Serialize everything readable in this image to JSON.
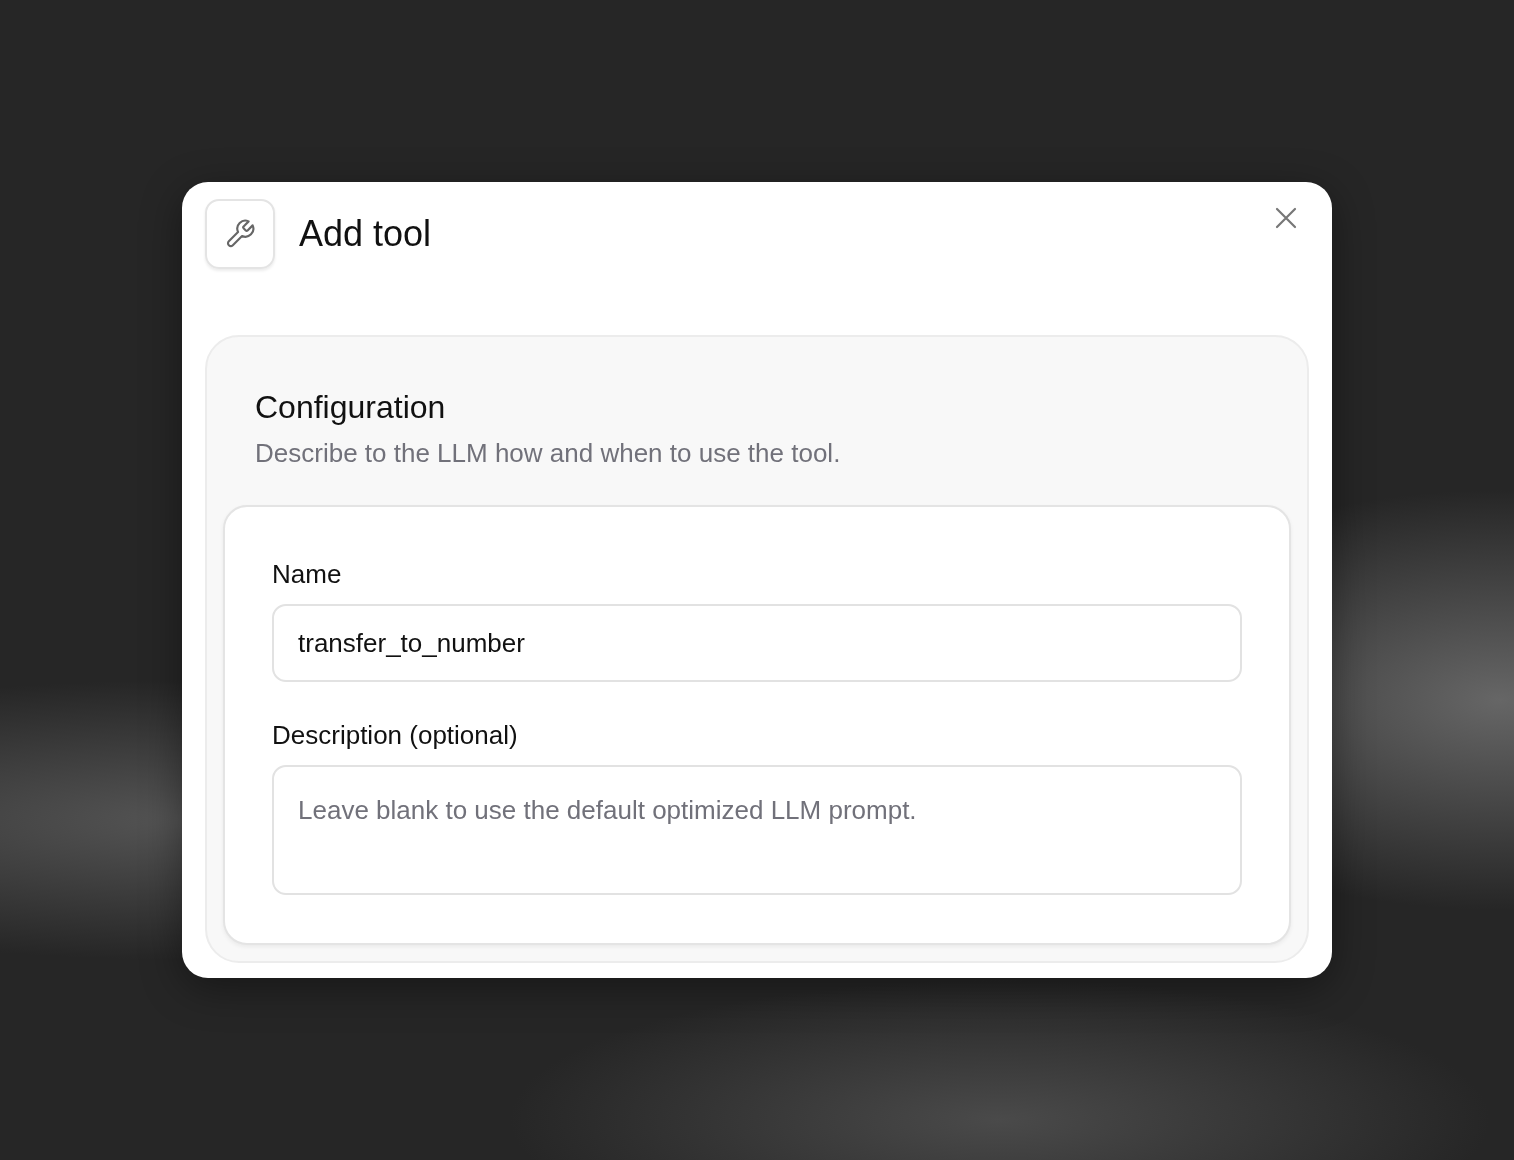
{
  "dialog": {
    "title": "Add tool"
  },
  "configuration": {
    "heading": "Configuration",
    "description": "Describe to the LLM how and when to use the tool.",
    "fields": [
      {
        "kind": "text",
        "label": "Name",
        "value": "transfer_to_number"
      },
      {
        "kind": "textarea",
        "label": "Description (optional)",
        "placeholder": "Leave blank to use the default optimized LLM prompt."
      }
    ]
  }
}
